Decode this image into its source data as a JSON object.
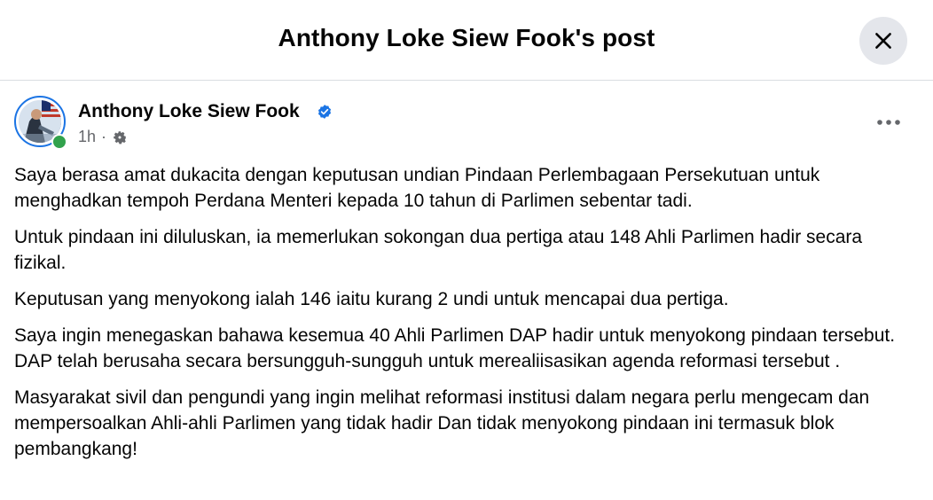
{
  "dialog": {
    "title": "Anthony Loke Siew Fook's post",
    "close_icon": "close-icon"
  },
  "post": {
    "author": "Anthony Loke Siew Fook",
    "verified": true,
    "timestamp": "1h",
    "separator": "·",
    "audience_icon": "gear-icon",
    "more_icon": "more-options-icon",
    "paragraphs": [
      "Saya berasa amat dukacita dengan keputusan undian Pindaan Perlembagaan Persekutuan untuk menghadkan tempoh Perdana Menteri kepada 10 tahun di Parlimen sebentar tadi.",
      "Untuk pindaan ini diluluskan, ia memerlukan sokongan dua pertiga atau 148 Ahli Parlimen hadir secara fizikal.",
      "Keputusan yang menyokong ialah 146 iaitu kurang 2 undi untuk mencapai dua pertiga.",
      "Saya ingin menegaskan bahawa kesemua 40 Ahli Parlimen DAP hadir untuk menyokong pindaan tersebut.  DAP telah berusaha secara bersungguh-sungguh untuk merealiisasikan agenda reformasi tersebut .",
      "Masyarakat sivil dan pengundi yang ingin melihat reformasi institusi dalam negara perlu mengecam dan mempersoalkan Ahli-ahli Parlimen yang tidak hadir Dan tidak menyokong pindaan ini termasuk blok pembangkang!"
    ]
  },
  "colors": {
    "verified_blue": "#1b74e4",
    "online_green": "#31a24c",
    "meta_grey": "#65676b",
    "close_bg": "#e4e6eb"
  }
}
